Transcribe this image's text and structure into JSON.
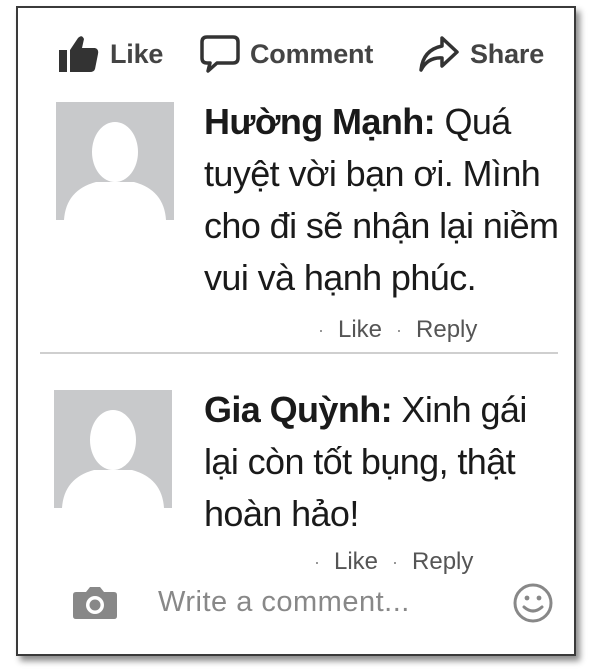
{
  "actions": {
    "like": "Like",
    "comment": "Comment",
    "share": "Share"
  },
  "comments": [
    {
      "author": "Hường Mạnh:",
      "lines": [
        "Quá",
        "tuyệt vời bạn ơi. Mình",
        "cho đi sẽ nhận lại niềm",
        "vui và hạnh phúc."
      ],
      "like_label": "Like",
      "reply_label": "Reply"
    },
    {
      "author": "Gia Quỳnh:",
      "lines": [
        "Xinh gái",
        "lại còn tốt bụng, thật",
        "hoàn hảo!"
      ],
      "like_label": "Like",
      "reply_label": "Reply"
    }
  ],
  "composer": {
    "placeholder": "Write a comment..."
  },
  "icons": [
    "thumbs-up-icon",
    "speech-bubble-icon",
    "share-arrow-icon",
    "camera-icon",
    "smiley-icon",
    "avatar-placeholder-icon"
  ],
  "colors": {
    "icon_gray": "#444444",
    "avatar_bg": "#c8c9cb",
    "avatar_fg": "#ffffff"
  }
}
